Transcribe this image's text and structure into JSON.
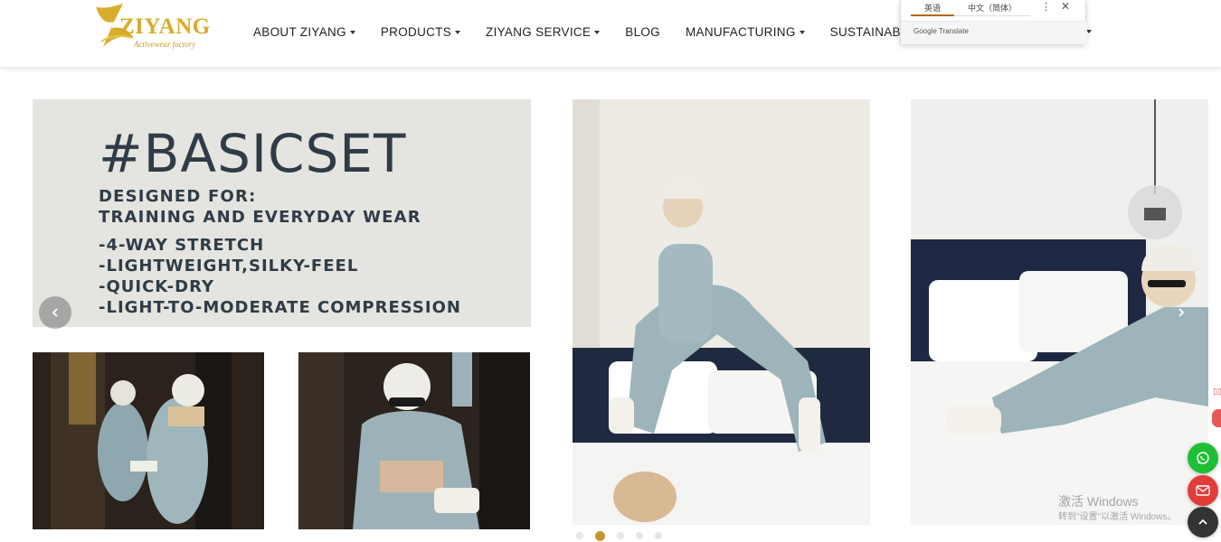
{
  "header": {
    "logo": {
      "text": "ZIYANG",
      "tagline": "Activewear factory"
    },
    "nav": [
      {
        "label": "ABOUT ZIYANG",
        "has_dropdown": true
      },
      {
        "label": "PRODUCTS",
        "has_dropdown": true
      },
      {
        "label": "ZIYANG SERVICE",
        "has_dropdown": true
      },
      {
        "label": "BLOG",
        "has_dropdown": false
      },
      {
        "label": "MANUFACTURING",
        "has_dropdown": true
      },
      {
        "label": "SUSTAINABILITY",
        "has_dropdown": true
      }
    ]
  },
  "translate_popup": {
    "tab_source": "英语",
    "tab_target": "中文（简体）",
    "menu_icon": "more-vertical-icon",
    "close_icon": "close-icon",
    "brand": "Google Translate"
  },
  "banner": {
    "title": "#BASICSET",
    "designed_lines": [
      "DESIGNED FOR:",
      "TRAINING AND EVERYDAY WEAR"
    ],
    "features": [
      "-4-WAY STRETCH",
      "-LIGHTWEIGHT,SILKY-FEEL",
      "-QUICK-DRY",
      "-LIGHT-TO-MODERATE COMPRESSION"
    ],
    "bg_color": "#e4e4e0",
    "text_color": "#2f3c46"
  },
  "carousel": {
    "prev_icon": "chevron-left-icon",
    "next_icon": "chevron-right-icon",
    "dot_count": 5,
    "active_dot": 2,
    "accent_color": "#c4962c"
  },
  "watermark": {
    "line1": "激活 Windows",
    "line2": "转到\"设置\"以激活 Windows。"
  },
  "floating": {
    "whatsapp_icon": "whatsapp-icon",
    "mail_icon": "mail-icon",
    "top_icon": "chevron-up-icon"
  }
}
